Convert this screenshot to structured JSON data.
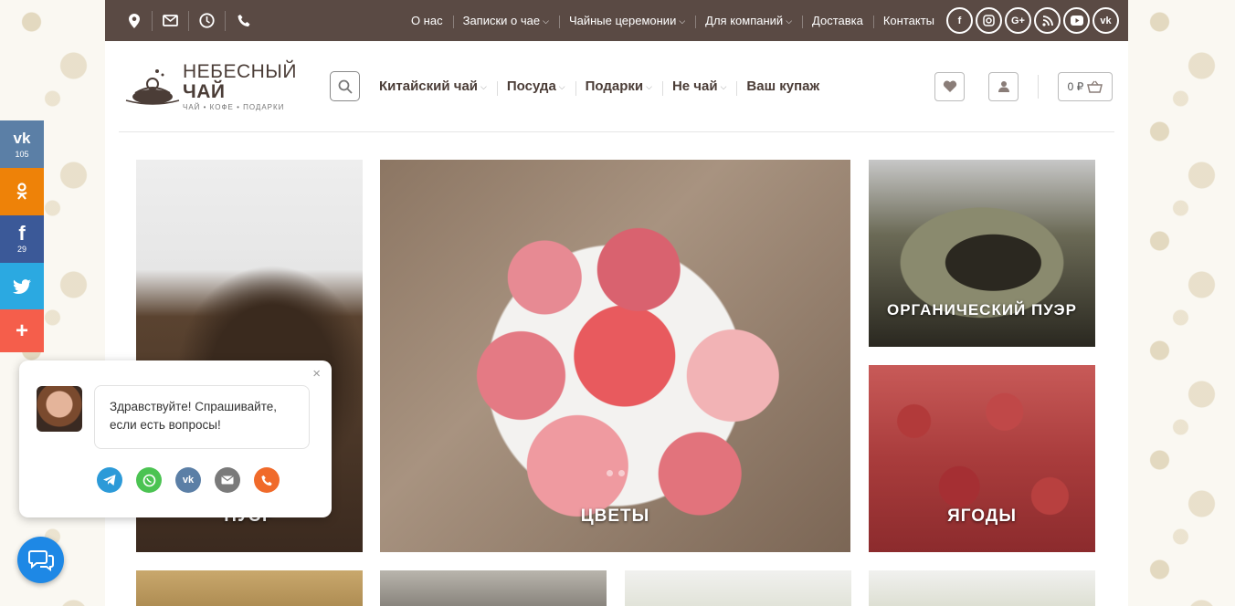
{
  "topbar": {
    "nav": [
      {
        "label": "О нас",
        "dropdown": false
      },
      {
        "label": "Записки о чае",
        "dropdown": true
      },
      {
        "label": "Чайные церемонии",
        "dropdown": true
      },
      {
        "label": "Для компаний",
        "dropdown": true
      },
      {
        "label": "Доставка",
        "dropdown": false
      },
      {
        "label": "Контакты",
        "dropdown": false
      }
    ],
    "social": [
      "f",
      "ig",
      "G+",
      "rss",
      "yt",
      "vk"
    ]
  },
  "logo": {
    "title_plain": "НЕБЕСНЫЙ ",
    "title_bold": "ЧАЙ",
    "subtitle": "ЧАЙ • КОФЕ • ПОДАРКИ"
  },
  "mainnav": [
    {
      "label": "Китайский чай",
      "dropdown": true
    },
    {
      "label": "Посуда",
      "dropdown": true
    },
    {
      "label": "Подарки",
      "dropdown": true
    },
    {
      "label": "Не чай",
      "dropdown": true
    },
    {
      "label": "Ваш купаж",
      "dropdown": false
    }
  ],
  "cart": {
    "amount": "0 ₽"
  },
  "tiles": {
    "puer": "ПУЭР",
    "flowers": "ЦВЕТЫ",
    "organic": "ОРГАНИЧЕСКИЙ ПУЭР",
    "berries": "ЯГОДЫ"
  },
  "share": {
    "vk_count": "105",
    "fb_count": "29"
  },
  "chat": {
    "greeting": "Здравствуйте! Спрашивайте, если есть вопросы!",
    "close": "×"
  },
  "colors": {
    "topbar": "#5a4a44",
    "text": "#4b3d37",
    "vk": "#5b7fa6",
    "ok": "#ee8208",
    "fb": "#3b5998",
    "tw": "#2ba9e1",
    "more": "#f55e4b"
  }
}
